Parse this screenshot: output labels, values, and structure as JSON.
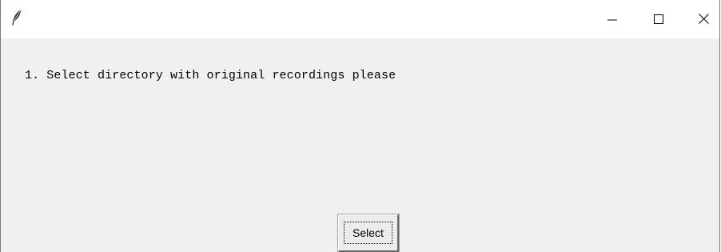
{
  "window": {
    "icon": "feather-icon",
    "controls": {
      "minimize_icon": "minimize-icon",
      "maximize_icon": "maximize-icon",
      "close_icon": "close-icon"
    }
  },
  "main": {
    "instruction_text": "1. Select directory with original recordings please",
    "select_button_label": "Select"
  },
  "colors": {
    "content_background": "#f0f0f0",
    "titlebar_background": "#ffffff",
    "text": "#000000"
  }
}
